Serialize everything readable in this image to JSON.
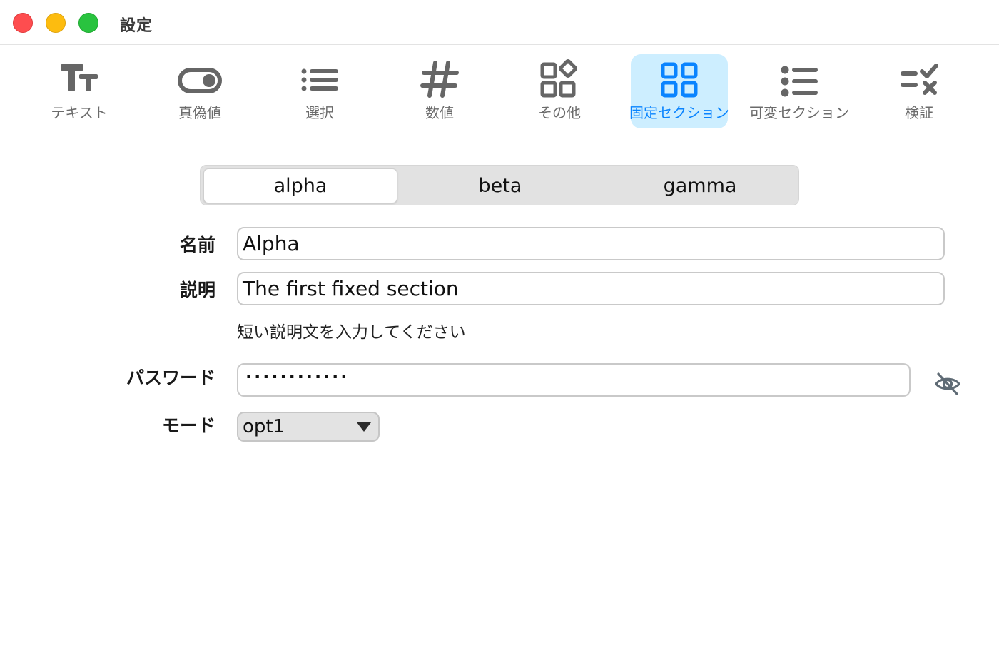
{
  "window": {
    "title": "設定"
  },
  "toolbar": {
    "items": [
      {
        "label": "テキスト",
        "icon": "text-format-icon",
        "active": false
      },
      {
        "label": "真偽値",
        "icon": "toggle-icon",
        "active": false
      },
      {
        "label": "選択",
        "icon": "list-icon",
        "active": false
      },
      {
        "label": "数値",
        "icon": "hash-icon",
        "active": false
      },
      {
        "label": "その他",
        "icon": "widgets-icon",
        "active": false
      },
      {
        "label": "固定セクション",
        "icon": "grid-icon",
        "active": true
      },
      {
        "label": "可変セクション",
        "icon": "bulleted-list-icon",
        "active": false
      },
      {
        "label": "検証",
        "icon": "checklist-icon",
        "active": false
      }
    ]
  },
  "segments": {
    "items": [
      "alpha",
      "beta",
      "gamma"
    ],
    "selected": "alpha"
  },
  "form": {
    "name_label": "名前",
    "name_value": "Alpha",
    "desc_label": "説明",
    "desc_value": "The first fixed section",
    "desc_hint": "短い説明文を入力してください",
    "password_label": "パスワード",
    "password_value": "············",
    "mode_label": "モード",
    "mode_value": "opt1"
  },
  "colors": {
    "accent": "#0a84ff",
    "active_tab_bg": "#cdeeff",
    "icon_gray": "#666666"
  }
}
